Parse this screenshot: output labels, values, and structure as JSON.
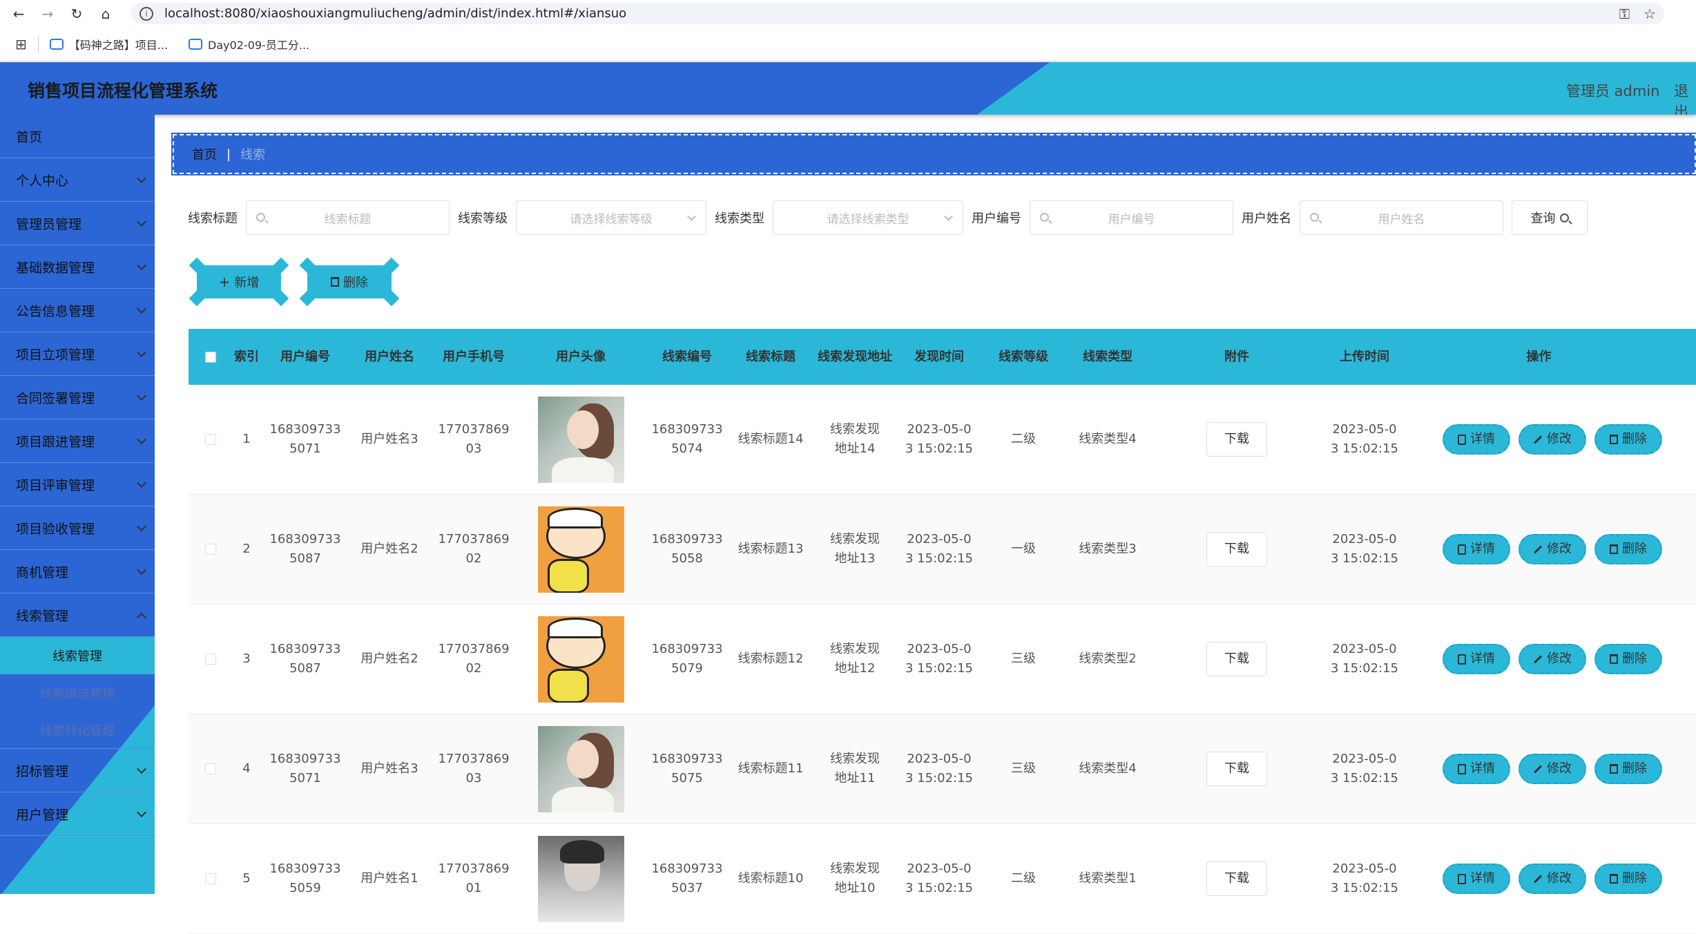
{
  "browser": {
    "url": "localhost:8080/xiaoshouxiangmuliucheng/admin/dist/index.html#/xiansuo",
    "bookmarks": [
      "【码神之路】项目...",
      "Day02-09-员工分..."
    ]
  },
  "header": {
    "title": "销售项目流程化管理系统",
    "admin": "管理员 admin",
    "logout": "退出"
  },
  "sidebar": {
    "items": [
      {
        "label": "首页"
      },
      {
        "label": "个人中心"
      },
      {
        "label": "管理员管理"
      },
      {
        "label": "基础数据管理"
      },
      {
        "label": "公告信息管理"
      },
      {
        "label": "项目立项管理"
      },
      {
        "label": "合同签署管理"
      },
      {
        "label": "项目跟进管理"
      },
      {
        "label": "项目评审管理"
      },
      {
        "label": "项目验收管理"
      },
      {
        "label": "商机管理"
      },
      {
        "label": "线索管理"
      }
    ],
    "sub_items": [
      "线索管理",
      "线索跟进管理",
      "线索转化管理"
    ],
    "after_items": [
      "招标管理",
      "用户管理"
    ]
  },
  "breadcrumb": {
    "home": "首页",
    "sep": "|",
    "current": "线索"
  },
  "search": {
    "title_label": "线索标题",
    "title_placeholder": "线索标题",
    "level_label": "线索等级",
    "level_placeholder": "请选择线索等级",
    "type_label": "线索类型",
    "type_placeholder": "请选择线索类型",
    "userno_label": "用户编号",
    "userno_placeholder": "用户编号",
    "username_label": "用户姓名",
    "username_placeholder": "用户姓名",
    "query_label": "查询"
  },
  "actions": {
    "add": "新增",
    "delete": "删除"
  },
  "table": {
    "headers": [
      "索引",
      "用户编号",
      "用户姓名",
      "用户手机号",
      "用户头像",
      "线索编号",
      "线索标题",
      "线索发现地址",
      "发现时间",
      "线索等级",
      "线索类型",
      "附件",
      "上传时间",
      "操作"
    ],
    "download": "下载",
    "ops": {
      "detail": "详情",
      "edit": "修改",
      "delete": "删除"
    },
    "rows": [
      {
        "idx": "1",
        "userno": "1683097335071",
        "username": "用户姓名3",
        "phone": "17703786903",
        "avatar": "girl",
        "clueno": "1683097335074",
        "title": "线索标题14",
        "addr": "线索发现地址14",
        "time": "2023-05-03 15:02:15",
        "level": "二级",
        "type": "线索类型4",
        "upload": "2023-05-03 15:02:15"
      },
      {
        "idx": "2",
        "userno": "1683097335087",
        "username": "用户姓名2",
        "phone": "17703786902",
        "avatar": "cartoon",
        "clueno": "1683097335058",
        "title": "线索标题13",
        "addr": "线索发现地址13",
        "time": "2023-05-03 15:02:15",
        "level": "一级",
        "type": "线索类型3",
        "upload": "2023-05-03 15:02:15"
      },
      {
        "idx": "3",
        "userno": "1683097335087",
        "username": "用户姓名2",
        "phone": "17703786902",
        "avatar": "cartoon",
        "clueno": "1683097335079",
        "title": "线索标题12",
        "addr": "线索发现地址12",
        "time": "2023-05-03 15:02:15",
        "level": "三级",
        "type": "线索类型2",
        "upload": "2023-05-03 15:02:15"
      },
      {
        "idx": "4",
        "userno": "1683097335071",
        "username": "用户姓名3",
        "phone": "17703786903",
        "avatar": "girl",
        "clueno": "1683097335075",
        "title": "线索标题11",
        "addr": "线索发现地址11",
        "time": "2023-05-03 15:02:15",
        "level": "三级",
        "type": "线索类型4",
        "upload": "2023-05-03 15:02:15"
      },
      {
        "idx": "5",
        "userno": "1683097335059",
        "username": "用户姓名1",
        "phone": "17703786901",
        "avatar": "man",
        "clueno": "1683097335037",
        "title": "线索标题10",
        "addr": "线索发现地址10",
        "time": "2023-05-03 15:02:15",
        "level": "二级",
        "type": "线索类型1",
        "upload": "2023-05-03 15:02:15"
      }
    ]
  },
  "colors": {
    "primary": "#2b66d4",
    "accent": "#2bb8d8"
  }
}
